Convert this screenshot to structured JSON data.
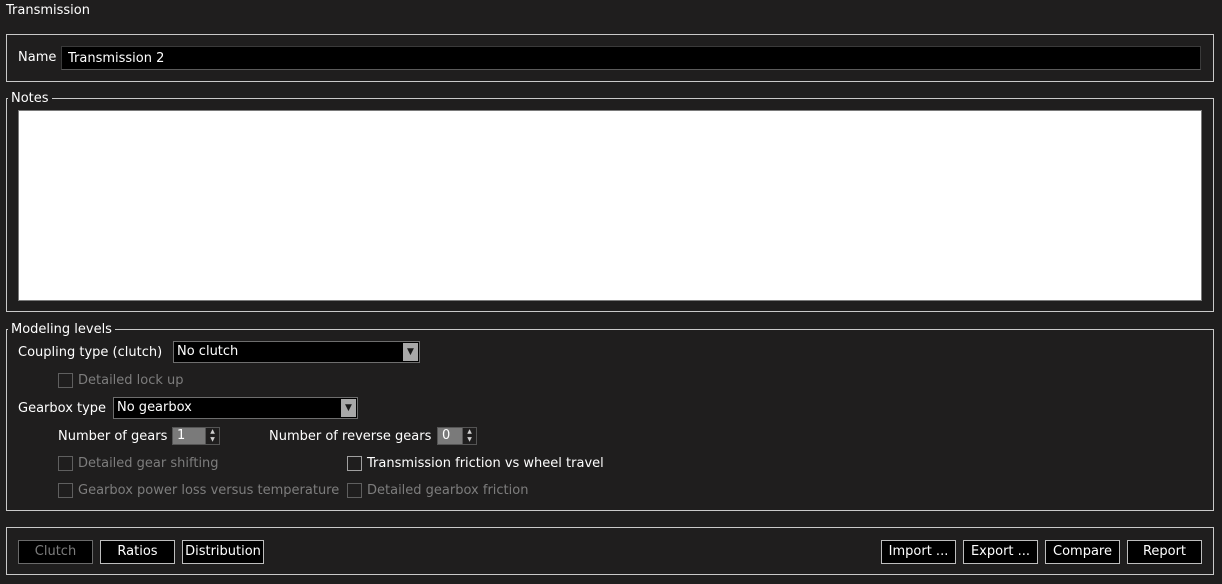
{
  "window": {
    "title": "Transmission"
  },
  "name_field": {
    "label": "Name",
    "value": "Transmission 2"
  },
  "notes": {
    "legend": "Notes",
    "value": ""
  },
  "modeling": {
    "legend": "Modeling levels",
    "coupling_label": "Coupling type (clutch)",
    "coupling_value": "No clutch",
    "detailed_lockup_label": "Detailed lock up",
    "gearbox_label": "Gearbox type",
    "gearbox_value": "No gearbox",
    "num_gears_label": "Number of gears",
    "num_gears_value": "1",
    "num_reverse_label": "Number of reverse gears",
    "num_reverse_value": "0",
    "detailed_shifting_label": "Detailed gear shifting",
    "friction_travel_label": "Transmission friction vs wheel travel",
    "power_loss_label": "Gearbox power loss versus temperature",
    "detailed_friction_label": "Detailed gearbox friction"
  },
  "bottom": {
    "clutch": "Clutch",
    "ratios": "Ratios",
    "distribution": "Distribution",
    "import": "Import ...",
    "export": "Export ...",
    "compare": "Compare",
    "report": "Report"
  },
  "icons": {
    "dropdown": "chevron-down-icon",
    "spin_up": "arrow-up-icon",
    "spin_down": "arrow-down-icon"
  }
}
